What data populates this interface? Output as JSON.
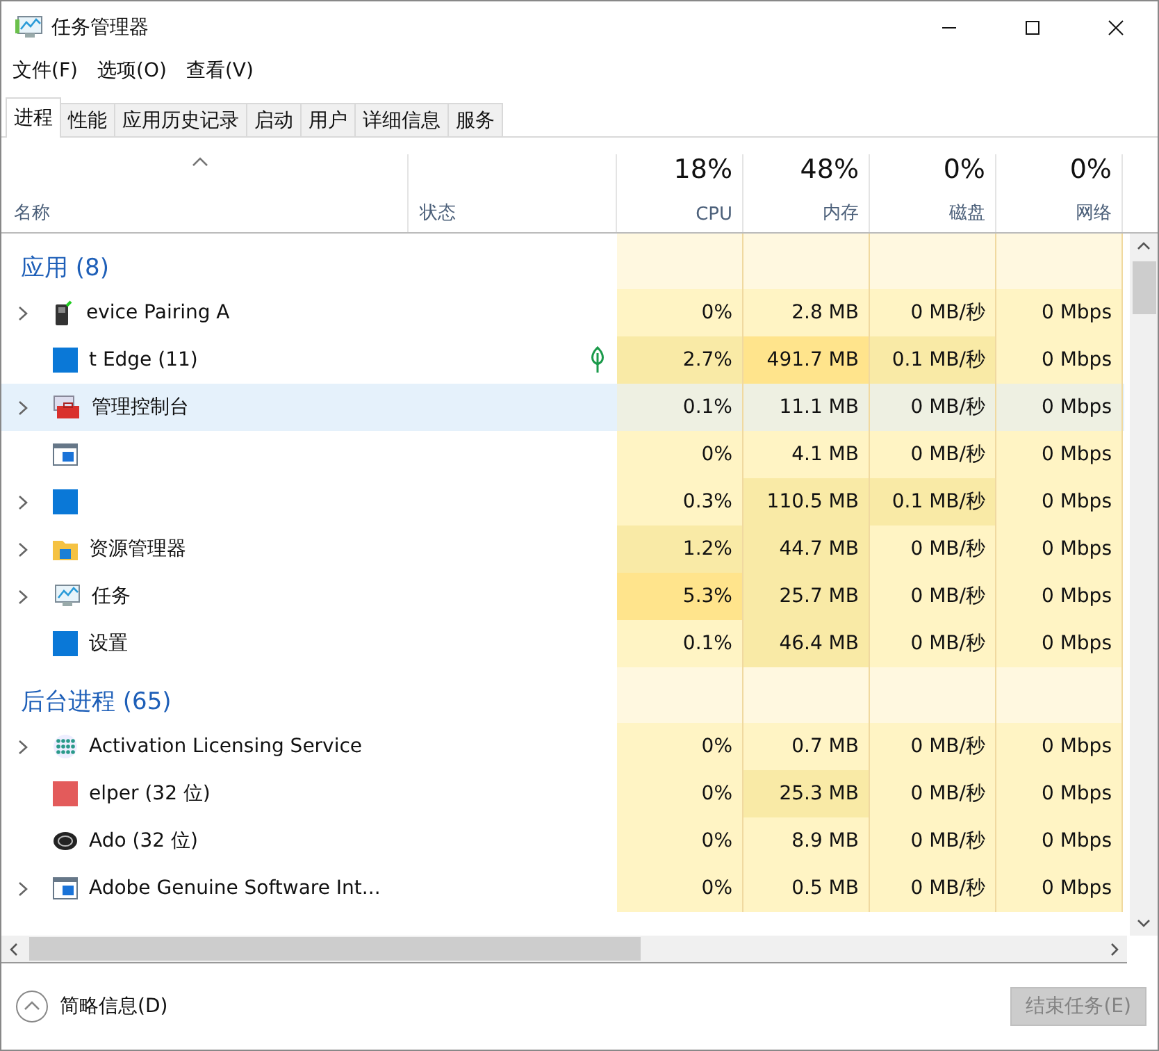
{
  "window": {
    "title": "任务管理器"
  },
  "menu": [
    "文件(F)",
    "选项(O)",
    "查看(V)"
  ],
  "tabs": [
    {
      "label": "进程",
      "selected": true
    },
    {
      "label": "性能",
      "selected": false
    },
    {
      "label": "应用历史记录",
      "selected": false
    },
    {
      "label": "启动",
      "selected": false
    },
    {
      "label": "用户",
      "selected": false
    },
    {
      "label": "详细信息",
      "selected": false
    },
    {
      "label": "服务",
      "selected": false
    }
  ],
  "columns": [
    {
      "label": "名称"
    },
    {
      "label": "状态"
    },
    {
      "label": "CPU",
      "total": "18%"
    },
    {
      "label": "内存",
      "total": "48%"
    },
    {
      "label": "磁盘",
      "total": "0%"
    },
    {
      "label": "网络",
      "total": "0%"
    }
  ],
  "groups": [
    {
      "title": "应用 (8)",
      "rows": [
        {
          "name": "evice Pairing A",
          "kind": "device",
          "expandable": true,
          "selected": false,
          "efficiency": false,
          "cpu": "0%",
          "memory": "2.8 MB",
          "disk": "0 MB/秒",
          "network": "0 Mbps"
        },
        {
          "name": "t Edge (11)",
          "kind": "blue",
          "expandable": false,
          "selected": false,
          "efficiency": true,
          "cpu": "2.7%",
          "memory": "491.7 MB",
          "disk": "0.1 MB/秒",
          "network": "0 Mbps"
        },
        {
          "name": "管理控制台",
          "kind": "toolbox",
          "expandable": true,
          "selected": true,
          "efficiency": false,
          "cpu": "0.1%",
          "memory": "11.1 MB",
          "disk": "0 MB/秒",
          "network": "0 Mbps"
        },
        {
          "kind": "window",
          "expandable": false,
          "selected": false,
          "efficiency": false,
          "cpu": "0%",
          "memory": "4.1 MB",
          "disk": "0 MB/秒",
          "network": "0 Mbps"
        },
        {
          "kind": "blue",
          "expandable": true,
          "selected": false,
          "efficiency": false,
          "cpu": "0.3%",
          "memory": "110.5 MB",
          "disk": "0.1 MB/秒",
          "network": "0 Mbps"
        },
        {
          "name": "资源管理器",
          "kind": "folder",
          "expandable": true,
          "selected": false,
          "efficiency": false,
          "cpu": "1.2%",
          "memory": "44.7 MB",
          "disk": "0 MB/秒",
          "network": "0 Mbps"
        },
        {
          "name": "任务",
          "kind": "monitor",
          "expandable": true,
          "selected": false,
          "efficiency": false,
          "cpu": "5.3%",
          "memory": "25.7 MB",
          "disk": "0 MB/秒",
          "network": "0 Mbps"
        },
        {
          "name": "设置",
          "kind": "blue",
          "expandable": false,
          "selected": false,
          "efficiency": false,
          "cpu": "0.1%",
          "memory": "46.4 MB",
          "disk": "0 MB/秒",
          "network": "0 Mbps"
        }
      ]
    },
    {
      "title": "后台进程 (65)",
      "rows": [
        {
          "name": "Activation Licensing Service",
          "kind": "dots",
          "expandable": true,
          "selected": false,
          "efficiency": false,
          "cpu": "0%",
          "memory": "0.7 MB",
          "disk": "0 MB/秒",
          "network": "0 Mbps"
        },
        {
          "name": "elper (32 位)",
          "kind": "red",
          "expandable": false,
          "selected": false,
          "efficiency": false,
          "cpu": "0%",
          "memory": "25.3 MB",
          "disk": "0 MB/秒",
          "network": "0 Mbps"
        },
        {
          "name": "Ado (32 位)",
          "kind": "cloud",
          "expandable": false,
          "selected": false,
          "efficiency": false,
          "cpu": "0%",
          "memory": "8.9 MB",
          "disk": "0 MB/秒",
          "network": "0 Mbps"
        },
        {
          "name": "Adobe Genuine Software Int...",
          "kind": "window",
          "expandable": true,
          "selected": false,
          "efficiency": false,
          "cpu": "0%",
          "memory": "0.5 MB",
          "disk": "0 MB/秒",
          "network": "0 Mbps"
        }
      ]
    }
  ],
  "footer": {
    "details_toggle": "简略信息(D)",
    "end_task": {
      "label": "结束任务(E)",
      "disabled": true
    }
  }
}
